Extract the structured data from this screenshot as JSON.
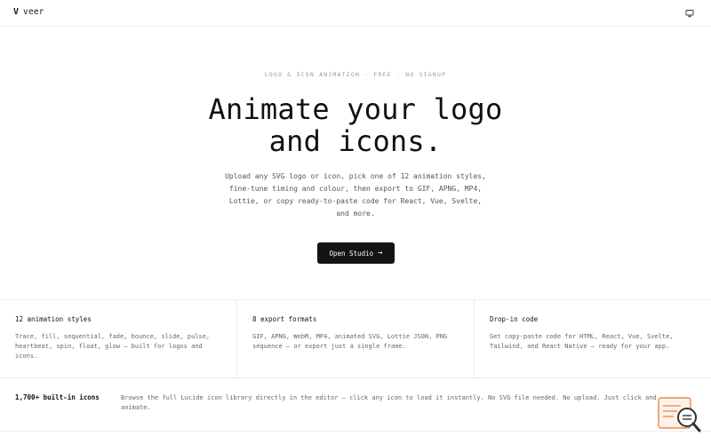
{
  "brand": {
    "mark": "V",
    "name": "veer"
  },
  "header": {
    "display_icon": "monitor-icon"
  },
  "hero": {
    "eyebrow": "LOGO & ICON ANIMATION · FREE · NO SIGNUP",
    "headline_line1": "Animate your logo",
    "headline_line2": "and icons.",
    "subcopy": "Upload any SVG logo or icon, pick one of 12 animation styles, fine-tune timing and colour, then export to GIF, APNG, MP4, Lottie, or copy ready-to-paste code for React, Vue, Svelte, and more.",
    "cta_label": "Open Studio",
    "cta_icon": "arrow-right-icon"
  },
  "features": [
    {
      "title": "12 animation styles",
      "desc": "Trace, fill, sequential, fade, bounce, slide, pulse, heartbeat, spin, float, glow — built for logos and icons."
    },
    {
      "title": "8 export formats",
      "desc": "GIF, APNG, WebM, MP4, animated SVG, Lottie JSON, PNG sequence — or export just a single frame."
    },
    {
      "title": "Drop-in code",
      "desc": "Get copy-paste code for HTML, React, Vue, Svelte, Tailwind, and React Native — ready for your app."
    }
  ],
  "icons_section": {
    "title": "1,700+ built-in icons",
    "desc": "Browse the full Lucide icon library directly in the editor — click any icon to load it instantly. No SVG file needed. No upload. Just click and animate."
  },
  "helper_badge": {
    "icon": "search-helper-icon",
    "accent": "#e8894a"
  },
  "colors": {
    "cta_bg": "#141414",
    "cta_text": "#ffffff",
    "border": "#ececec",
    "muted": "#666666"
  }
}
